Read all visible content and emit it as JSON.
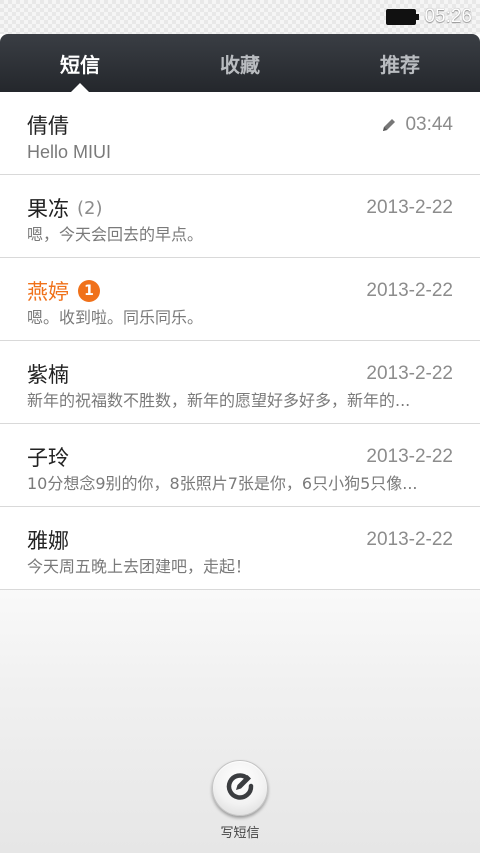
{
  "status_bar": {
    "time": "05:26"
  },
  "tabs": [
    {
      "label": "短信",
      "active": true
    },
    {
      "label": "收藏",
      "active": false
    },
    {
      "label": "推荐",
      "active": false
    }
  ],
  "messages": [
    {
      "name": "倩倩",
      "count": "",
      "unread": "",
      "time": "03:44",
      "draft": true,
      "preview": "Hello MIUI"
    },
    {
      "name": "果冻",
      "count": "(2)",
      "unread": "",
      "time": "2013-2-22",
      "draft": false,
      "preview": "嗯，今天会回去的早点。"
    },
    {
      "name": "燕婷",
      "count": "",
      "unread": "1",
      "time": "2013-2-22",
      "draft": false,
      "preview": "嗯。收到啦。同乐同乐。"
    },
    {
      "name": "紫楠",
      "count": "",
      "unread": "",
      "time": "2013-2-22",
      "draft": false,
      "preview": "新年的祝福数不胜数，新年的愿望好多好多，新年的..."
    },
    {
      "name": "子玲",
      "count": "",
      "unread": "",
      "time": "2013-2-22",
      "draft": false,
      "preview": "10分想念9别的你，8张照片7张是你，6只小狗5只像..."
    },
    {
      "name": "雅娜",
      "count": "",
      "unread": "",
      "time": "2013-2-22",
      "draft": false,
      "preview": "今天周五晚上去团建吧，走起！"
    }
  ],
  "compose": {
    "label": "写短信",
    "icon": "compose-icon"
  },
  "colors": {
    "accent": "#f0711a",
    "tab_bar": "#2b2e33"
  }
}
